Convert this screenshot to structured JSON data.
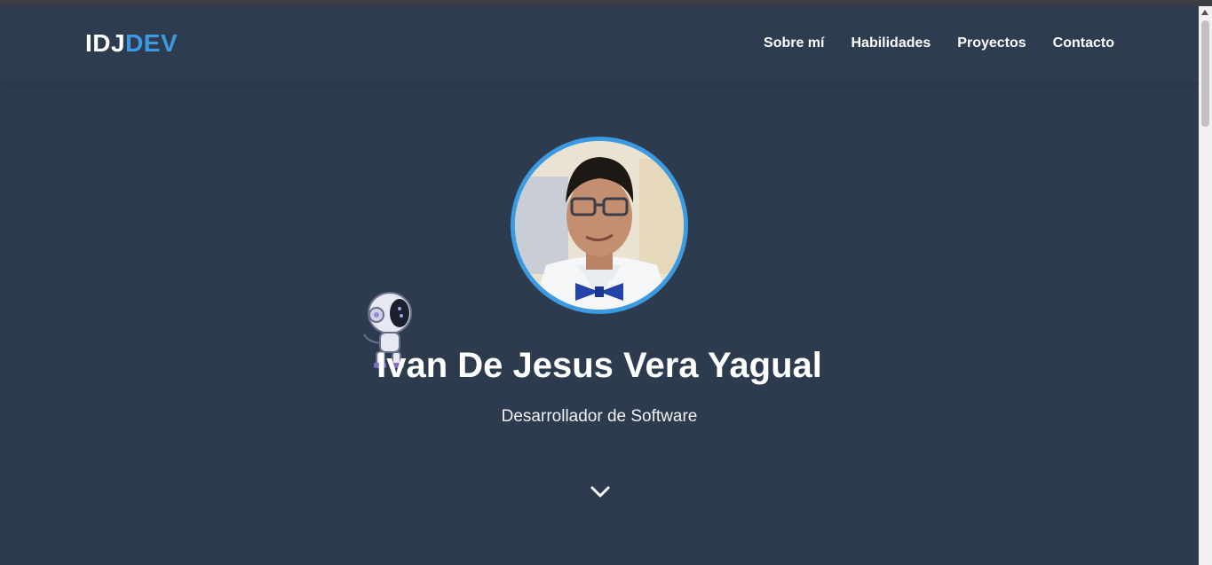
{
  "header": {
    "logo_part1": "IDJ",
    "logo_part2": "DEV",
    "nav": [
      "Sobre mí",
      "Habilidades",
      "Proyectos",
      "Contacto"
    ]
  },
  "hero": {
    "name": "Ivan De Jesus Vera Yagual",
    "subtitle": "Desarrollador de Software",
    "scroll_icon": "chevron-down-icon"
  },
  "colors": {
    "background": "#2d3b4f",
    "accent": "#3b9ae1",
    "text": "#ffffff"
  }
}
